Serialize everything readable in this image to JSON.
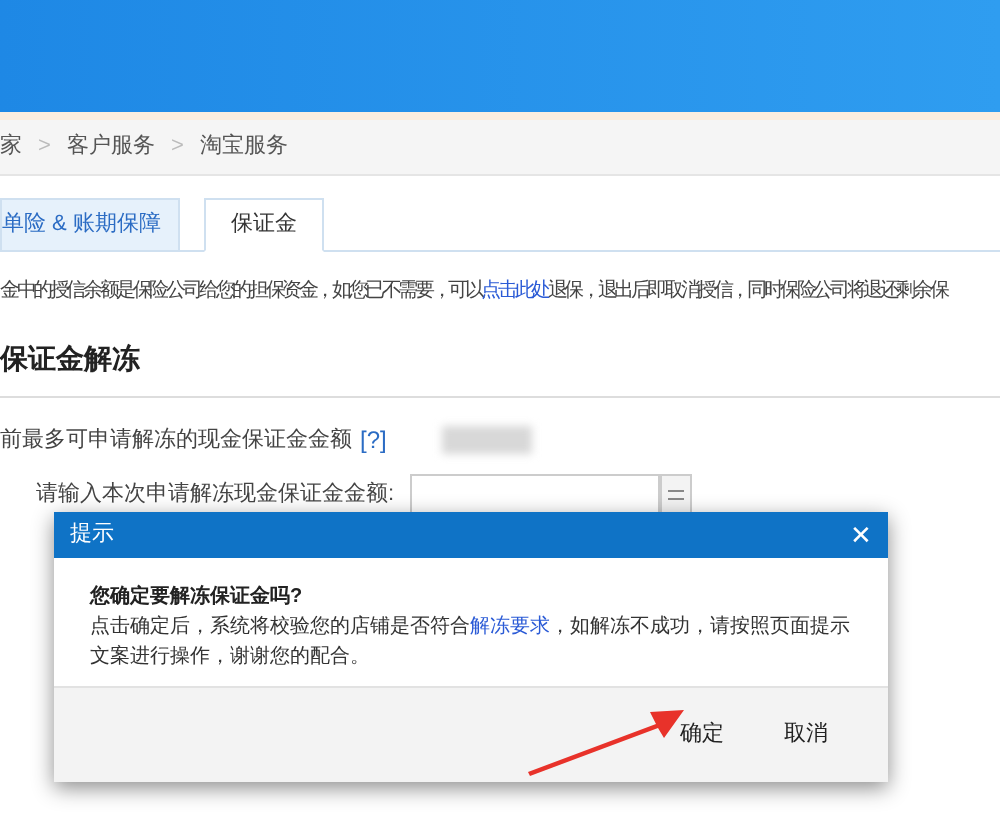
{
  "breadcrumb": [
    {
      "kind": "link",
      "text": "家"
    },
    {
      "kind": "separator",
      "text": ">"
    },
    {
      "kind": "link",
      "text": "客户服务"
    },
    {
      "kind": "separator",
      "text": ">"
    },
    {
      "kind": "link",
      "text": "淘宝服务"
    }
  ],
  "tabs": [
    {
      "label": "单险 & 账期保障",
      "selected": false
    },
    {
      "label": "保证金",
      "selected": true
    }
  ],
  "notice": {
    "before": "金中的授信余额是保险公司给您的担保资金，如您已不需要，可以",
    "link": "点击此处",
    "after": "退保，退出后即取消授信，同时保险公司将退还剩余保"
  },
  "section_title": "保证金解冻",
  "max_amount": {
    "label": "前最多可申请解冻的现金保证金金额",
    "help": "[?]"
  },
  "amount_input": {
    "label": "请输入本次申请解冻现金保证金金额:"
  },
  "dialog": {
    "title": "提示",
    "close": "✕",
    "question": "您确定要解冻保证金吗?",
    "message": {
      "before": "点击确定后，系统将校验您的店铺是否符合",
      "link": "解冻要求",
      "after": "，如解冻不成功，请按照页面提示文案进行操作，谢谢您的配合。"
    },
    "buttons": [
      "确定",
      "取消"
    ]
  }
}
